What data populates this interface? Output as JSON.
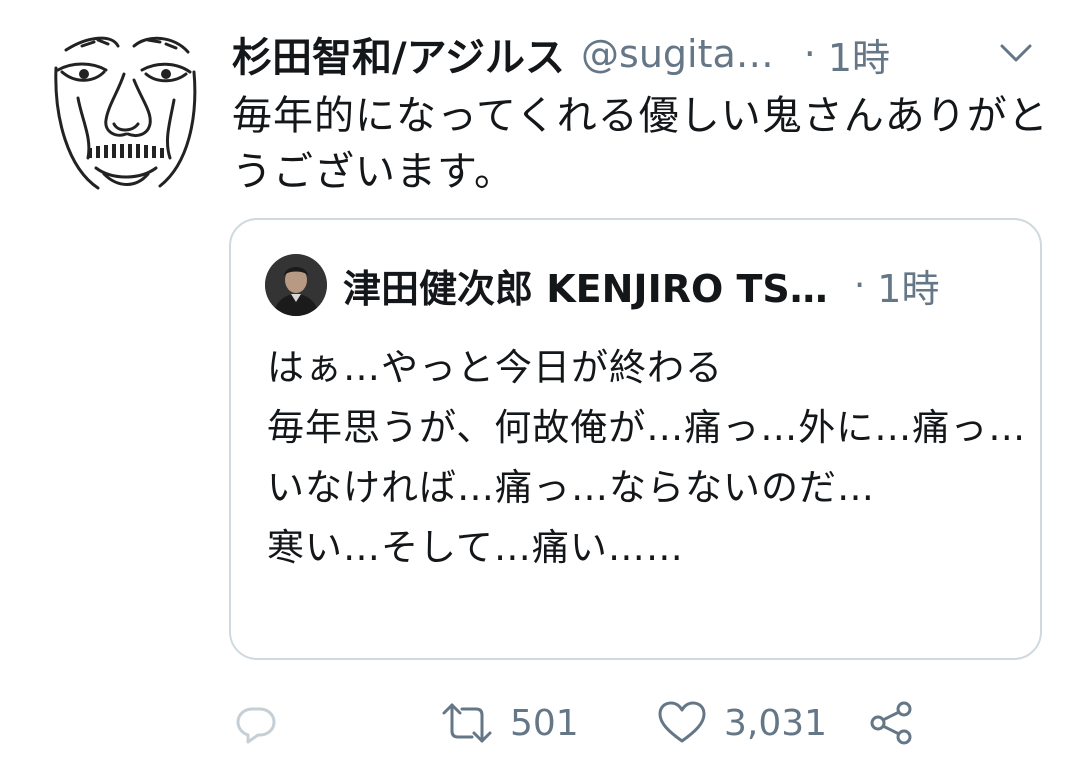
{
  "tweet": {
    "display_name": "杉田智和/アジルス",
    "handle": "@sugita…",
    "separator": "·",
    "time": "1時",
    "text": "毎年的になってくれる優しい鬼さんありがとうございます。"
  },
  "quoted_tweet": {
    "display_name": "津田健次郎 KENJIRO TS…",
    "separator": "·",
    "time": "1時",
    "text": "はぁ…やっと今日が終わる\n毎年思うが、何故俺が…痛っ…外に…痛っ…いなければ…痛っ…ならないのだ…\n寒い…そして…痛い……"
  },
  "actions": {
    "reply_icon": "reply-icon",
    "retweet_icon": "retweet-icon",
    "retweet_count": "501",
    "like_icon": "heart-icon",
    "like_count": "3,031",
    "share_icon": "share-icon"
  },
  "colors": {
    "text": "#14171a",
    "secondary": "#657786",
    "border": "#cfd9de",
    "icon_light": "#c4cfd6"
  }
}
